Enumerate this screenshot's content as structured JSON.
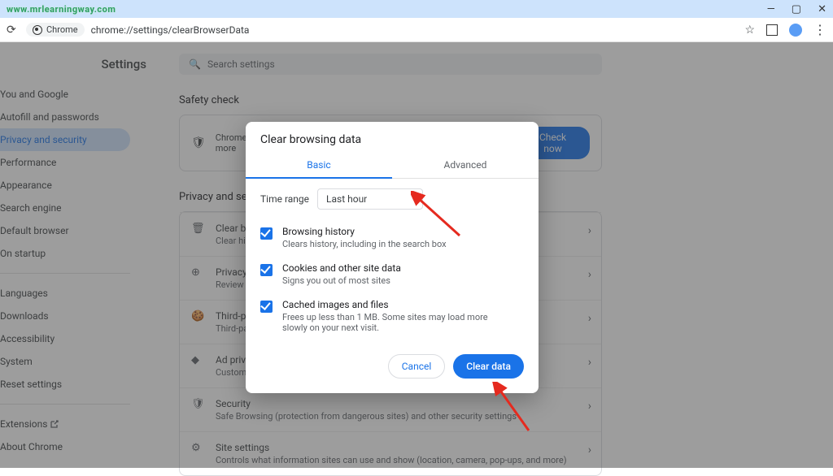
{
  "watermark": "www.mrlearningway.com",
  "win": {
    "min": "—",
    "max": "▢",
    "close": "✕"
  },
  "addr": {
    "chip": "Chrome",
    "url": "chrome://settings/clearBrowserData"
  },
  "sidebar": {
    "title": "Settings",
    "items": [
      "You and Google",
      "Autofill and passwords",
      "Privacy and security",
      "Performance",
      "Appearance",
      "Search engine",
      "Default browser",
      "On startup"
    ],
    "items2": [
      "Languages",
      "Downloads",
      "Accessibility",
      "System",
      "Reset settings"
    ],
    "items3": [
      "Extensions",
      "About Chrome"
    ]
  },
  "content": {
    "search_placeholder": "Search settings",
    "safety_title": "Safety check",
    "safety_text": "Chrome can help keep you safe from data breaches, bad extensions, and more",
    "check_now": "Check now",
    "privacy_title": "Privacy and security",
    "rows": [
      {
        "icon": "🗑",
        "title": "Clear browsing data",
        "sub": "Clear history, cookies, cache, and more"
      },
      {
        "icon": "⊕",
        "title": "Privacy Guide",
        "sub": "Review key privacy and security controls"
      },
      {
        "icon": "🍪",
        "title": "Third-party cookies",
        "sub": "Third-party cookies are blocked in Incognito mode"
      },
      {
        "icon": "◆",
        "title": "Ad privacy",
        "sub": "Customize the info used by sites to show you ads"
      },
      {
        "icon": "🛡",
        "title": "Security",
        "sub": "Safe Browsing (protection from dangerous sites) and other security settings"
      },
      {
        "icon": "⚙",
        "title": "Site settings",
        "sub": "Controls what information sites can use and show (location, camera, pop-ups, and more)"
      }
    ]
  },
  "dialog": {
    "title": "Clear browsing data",
    "tab_basic": "Basic",
    "tab_advanced": "Advanced",
    "time_range_label": "Time range",
    "time_range_value": "Last hour",
    "items": [
      {
        "title": "Browsing history",
        "sub": "Clears history, including in the search box"
      },
      {
        "title": "Cookies and other site data",
        "sub": "Signs you out of most sites"
      },
      {
        "title": "Cached images and files",
        "sub": "Frees up less than 1 MB. Some sites may load more slowly on your next visit."
      }
    ],
    "cancel": "Cancel",
    "clear": "Clear data"
  }
}
